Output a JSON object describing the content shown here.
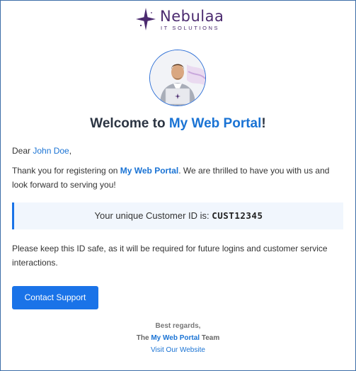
{
  "brand": {
    "name": "Nebulaa",
    "tagline": "IT SOLUTIONS",
    "color": "#4b2a6f",
    "star_icon": "four-point-star-icon"
  },
  "avatar": {
    "icon": "person-with-laptop-avatar"
  },
  "heading": {
    "prefix": "Welcome to ",
    "portal": "My Web Portal",
    "suffix": "!"
  },
  "greeting": {
    "dear": "Dear ",
    "name": "John Doe",
    "comma": ","
  },
  "thanks": {
    "prefix": "Thank you for registering on ",
    "portal": "My Web Portal",
    "suffix": ". We are thrilled to have you with us and look forward to serving you!"
  },
  "customer_id": {
    "label": "Your unique Customer ID is: ",
    "value": "CUST12345"
  },
  "notice": "Please keep this ID safe, as it will be required for future logins and customer service interactions.",
  "button": {
    "label": "Contact Support"
  },
  "footer": {
    "regards": "Best regards,",
    "team_prefix": "The ",
    "team_portal": "My Web Portal",
    "team_suffix": " Team",
    "link": "Visit Our Website"
  },
  "colors": {
    "accent": "#1a73d4",
    "button": "#1a73e8",
    "id_box_bg": "#f1f6fd"
  }
}
